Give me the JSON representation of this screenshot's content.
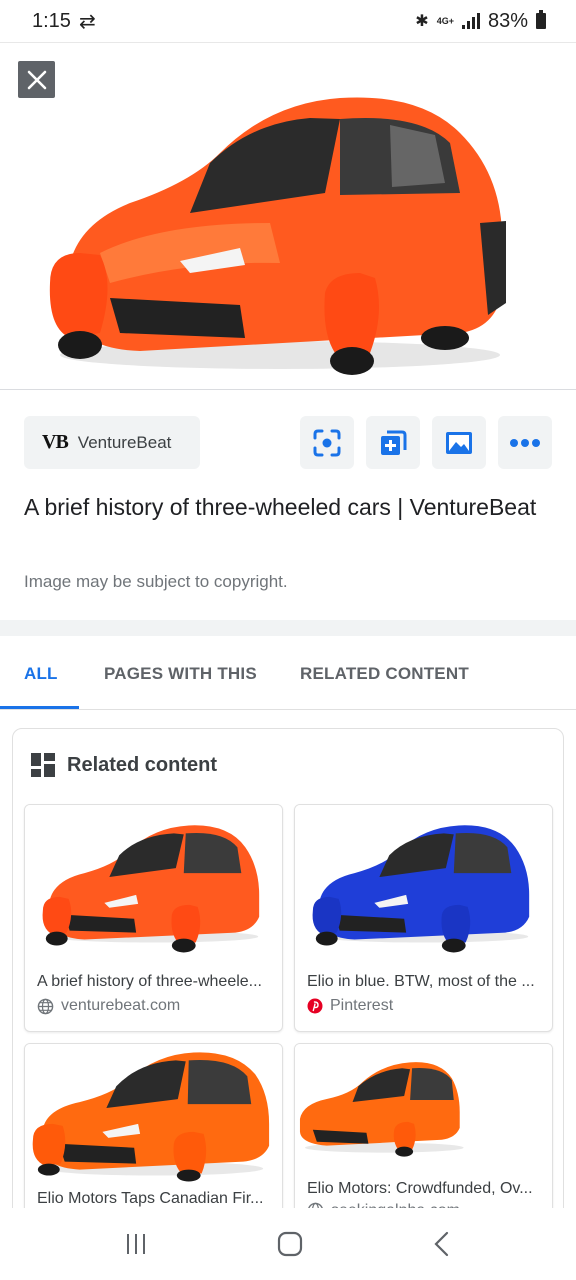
{
  "status_bar": {
    "time": "1:15",
    "network": "4G+",
    "battery": "83%"
  },
  "hero": {
    "close_icon": "close-icon",
    "image_subject": "orange three-wheeled car"
  },
  "source": {
    "logo": "VB",
    "name": "VentureBeat"
  },
  "actions": [
    "lens-icon",
    "add-to-collection-icon",
    "image-icon",
    "more-icon"
  ],
  "result": {
    "title": "A brief history of three-wheeled cars | VentureBeat",
    "copyright": "Image may be subject to copyright."
  },
  "tabs": [
    {
      "label": "ALL",
      "active": true
    },
    {
      "label": "PAGES WITH THIS",
      "active": false
    },
    {
      "label": "RELATED CONTENT",
      "active": false
    }
  ],
  "related": {
    "heading": "Related content",
    "items": [
      {
        "caption": "A brief history of three-wheele...",
        "source": "venturebeat.com",
        "source_icon": "globe-icon",
        "car_color": "#ff5a1f"
      },
      {
        "caption": "Elio in blue. BTW, most of the ...",
        "source": "Pinterest",
        "source_icon": "pinterest-icon",
        "car_color": "#1f3ed8"
      },
      {
        "caption": "Elio Motors Taps Canadian Fir...",
        "source": "",
        "source_icon": "",
        "car_color": "#ff6a10"
      },
      {
        "caption": "Elio Motors: Crowdfunded, Ov...",
        "source": "seekingalpha.com",
        "source_icon": "globe-icon",
        "car_color": "#ff6a10"
      }
    ]
  },
  "colors": {
    "accent": "#1a73e8",
    "car_orange": "#ff5a1f",
    "close_bg": "#5f6368"
  }
}
